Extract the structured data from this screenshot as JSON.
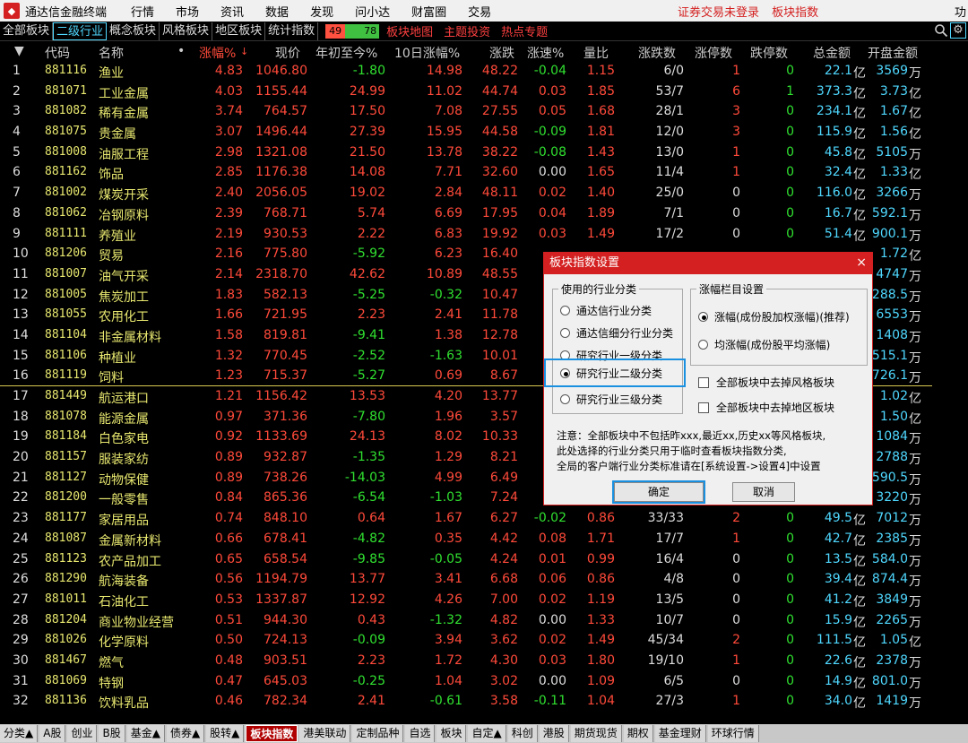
{
  "titlebar": {
    "app_title": "通达信金融终端",
    "menu": [
      "行情",
      "市场",
      "资讯",
      "数据",
      "发现",
      "问小达",
      "财富圈",
      "交易"
    ],
    "notice": [
      "证券交易未登录",
      "板块指数"
    ],
    "func": "功"
  },
  "tabbar": {
    "tabs": [
      "全部板块",
      "二级行业",
      "概念板块",
      "风格板块",
      "地区板块",
      "统计指数"
    ],
    "active_tab": "二级行业",
    "up_count": "49",
    "down_count": "78",
    "links": [
      "板块地图",
      "主题投资",
      "热点专题"
    ]
  },
  "header": {
    "cols": [
      "代码",
      "名称",
      "•",
      "涨幅%",
      "现价",
      "年初至今%",
      "10日涨幅%",
      "涨跌",
      "涨速%",
      "量比",
      "涨跌数",
      "涨停数",
      "跌停数",
      "总金额",
      "开盘金额"
    ]
  },
  "rows": [
    [
      "1",
      "881116",
      "渔业",
      "4.83",
      "1046.80",
      "-1.80",
      "14.98",
      "48.22",
      "-0.04",
      "1.15",
      "6/0",
      "1",
      "0",
      "22.1",
      "亿",
      "3569",
      "万"
    ],
    [
      "2",
      "881071",
      "工业金属",
      "4.03",
      "1155.44",
      "24.99",
      "11.02",
      "44.74",
      "0.03",
      "1.85",
      "53/7",
      "6",
      "1",
      "373.3",
      "亿",
      "3.73",
      "亿"
    ],
    [
      "3",
      "881082",
      "稀有金属",
      "3.74",
      "764.57",
      "17.50",
      "7.08",
      "27.55",
      "0.05",
      "1.68",
      "28/1",
      "3",
      "0",
      "234.1",
      "亿",
      "1.67",
      "亿"
    ],
    [
      "4",
      "881075",
      "贵金属",
      "3.07",
      "1496.44",
      "27.39",
      "15.95",
      "44.58",
      "-0.09",
      "1.81",
      "12/0",
      "3",
      "0",
      "115.9",
      "亿",
      "1.56",
      "亿"
    ],
    [
      "5",
      "881008",
      "油服工程",
      "2.98",
      "1321.08",
      "21.50",
      "13.78",
      "38.22",
      "-0.08",
      "1.43",
      "13/0",
      "1",
      "0",
      "45.8",
      "亿",
      "5105",
      "万"
    ],
    [
      "6",
      "881162",
      "饰品",
      "2.85",
      "1176.38",
      "14.08",
      "7.71",
      "32.60",
      "0.00",
      "1.65",
      "11/4",
      "1",
      "0",
      "32.4",
      "亿",
      "1.33",
      "亿"
    ],
    [
      "7",
      "881002",
      "煤炭开采",
      "2.40",
      "2056.05",
      "19.02",
      "2.84",
      "48.11",
      "0.02",
      "1.40",
      "25/0",
      "0",
      "0",
      "116.0",
      "亿",
      "3266",
      "万"
    ],
    [
      "8",
      "881062",
      "冶钢原料",
      "2.39",
      "768.71",
      "5.74",
      "6.69",
      "17.95",
      "0.04",
      "1.89",
      "7/1",
      "0",
      "0",
      "16.7",
      "亿",
      "592.1",
      "万"
    ],
    [
      "9",
      "881111",
      "养殖业",
      "2.19",
      "930.53",
      "2.22",
      "6.83",
      "19.92",
      "0.03",
      "1.49",
      "17/2",
      "0",
      "0",
      "51.4",
      "亿",
      "900.1",
      "万"
    ],
    [
      "10",
      "881206",
      "贸易",
      "2.16",
      "775.80",
      "-5.92",
      "6.23",
      "16.40",
      "",
      "",
      "",
      "",
      "",
      "",
      "",
      "1.72",
      "亿"
    ],
    [
      "11",
      "881007",
      "油气开采",
      "2.14",
      "2318.70",
      "42.62",
      "10.89",
      "48.55",
      "",
      "",
      "",
      "",
      "",
      "",
      "",
      "4747",
      "万"
    ],
    [
      "12",
      "881005",
      "焦炭加工",
      "1.83",
      "582.13",
      "-5.25",
      "-0.32",
      "10.47",
      "",
      "",
      "",
      "",
      "",
      "",
      "",
      "288.5",
      "万"
    ],
    [
      "13",
      "881055",
      "农用化工",
      "1.66",
      "721.95",
      "2.23",
      "2.41",
      "11.78",
      "",
      "",
      "",
      "",
      "",
      "",
      "",
      "6553",
      "万"
    ],
    [
      "14",
      "881104",
      "非金属材料",
      "1.58",
      "819.81",
      "-9.41",
      "1.38",
      "12.78",
      "",
      "",
      "",
      "",
      "",
      "",
      "",
      "1408",
      "万"
    ],
    [
      "15",
      "881106",
      "种植业",
      "1.32",
      "770.45",
      "-2.52",
      "-1.63",
      "10.01",
      "",
      "",
      "",
      "",
      "",
      "",
      "",
      "515.1",
      "万"
    ],
    [
      "16",
      "881119",
      "饲料",
      "1.23",
      "715.37",
      "-5.27",
      "0.69",
      "8.67",
      "",
      "",
      "",
      "",
      "",
      "",
      "",
      "726.1",
      "万"
    ],
    [
      "17",
      "881449",
      "航运港口",
      "1.21",
      "1156.42",
      "13.53",
      "4.20",
      "13.77",
      "",
      "",
      "",
      "",
      "",
      "",
      "",
      "1.02",
      "亿"
    ],
    [
      "18",
      "881078",
      "能源金属",
      "0.97",
      "371.36",
      "-7.80",
      "1.96",
      "3.57",
      "",
      "",
      "",
      "",
      "",
      "",
      "",
      "1.50",
      "亿"
    ],
    [
      "19",
      "881184",
      "白色家电",
      "0.92",
      "1133.69",
      "24.13",
      "8.02",
      "10.33",
      "",
      "",
      "",
      "",
      "",
      "",
      "",
      "1084",
      "万"
    ],
    [
      "20",
      "881157",
      "服装家纺",
      "0.89",
      "932.87",
      "-1.35",
      "1.29",
      "8.21",
      "",
      "",
      "",
      "",
      "",
      "",
      "",
      "2788",
      "万"
    ],
    [
      "21",
      "881127",
      "动物保健",
      "0.89",
      "738.26",
      "-14.03",
      "4.99",
      "6.49",
      "",
      "",
      "",
      "",
      "",
      "",
      "",
      "590.5",
      "万"
    ],
    [
      "22",
      "881200",
      "一般零售",
      "0.84",
      "865.36",
      "-6.54",
      "-1.03",
      "7.24",
      "",
      "",
      "",
      "",
      "",
      "",
      "",
      "3220",
      "万"
    ],
    [
      "23",
      "881177",
      "家居用品",
      "0.74",
      "848.10",
      "0.64",
      "1.67",
      "6.27",
      "-0.02",
      "0.86",
      "33/33",
      "2",
      "0",
      "49.5",
      "亿",
      "7012",
      "万"
    ],
    [
      "24",
      "881087",
      "金属新材料",
      "0.66",
      "678.41",
      "-4.82",
      "0.35",
      "4.42",
      "0.08",
      "1.71",
      "17/7",
      "1",
      "0",
      "42.7",
      "亿",
      "2385",
      "万"
    ],
    [
      "25",
      "881123",
      "农产品加工",
      "0.65",
      "658.54",
      "-9.85",
      "-0.05",
      "4.24",
      "0.01",
      "0.99",
      "16/4",
      "0",
      "0",
      "13.5",
      "亿",
      "584.0",
      "万"
    ],
    [
      "26",
      "881290",
      "航海装备",
      "0.56",
      "1194.79",
      "13.77",
      "3.41",
      "6.68",
      "0.06",
      "0.86",
      "4/8",
      "0",
      "0",
      "39.4",
      "亿",
      "874.4",
      "万"
    ],
    [
      "27",
      "881011",
      "石油化工",
      "0.53",
      "1337.87",
      "12.92",
      "4.26",
      "7.00",
      "0.02",
      "1.19",
      "13/5",
      "0",
      "0",
      "41.2",
      "亿",
      "3849",
      "万"
    ],
    [
      "28",
      "881204",
      "商业物业经营",
      "0.51",
      "944.30",
      "0.43",
      "-1.32",
      "4.82",
      "0.00",
      "1.33",
      "10/7",
      "0",
      "0",
      "15.9",
      "亿",
      "2265",
      "万"
    ],
    [
      "29",
      "881026",
      "化学原料",
      "0.50",
      "724.13",
      "-0.09",
      "3.94",
      "3.62",
      "0.02",
      "1.49",
      "45/34",
      "2",
      "0",
      "111.5",
      "亿",
      "1.05",
      "亿"
    ],
    [
      "30",
      "881467",
      "燃气",
      "0.48",
      "903.51",
      "2.23",
      "1.72",
      "4.30",
      "0.03",
      "1.80",
      "19/10",
      "1",
      "0",
      "22.6",
      "亿",
      "2378",
      "万"
    ],
    [
      "31",
      "881069",
      "特钢",
      "0.47",
      "645.03",
      "-0.25",
      "1.04",
      "3.02",
      "0.00",
      "1.09",
      "6/5",
      "0",
      "0",
      "14.9",
      "亿",
      "801.0",
      "万"
    ],
    [
      "32",
      "881136",
      "饮料乳品",
      "0.46",
      "782.34",
      "2.41",
      "-0.61",
      "3.58",
      "-0.11",
      "1.04",
      "27/3",
      "1",
      "0",
      "34.0",
      "亿",
      "1419",
      "万"
    ]
  ],
  "bottombar": {
    "tabs": [
      "分类▲",
      "A股",
      "创业",
      "B股",
      "基金▲",
      "债券▲",
      "股转▲",
      "板块指数",
      "港美联动",
      "定制品种",
      "自选",
      "板块",
      "自定▲",
      "科创",
      "港股",
      "期货现货",
      "期权",
      "基金理财",
      "环球行情"
    ],
    "active": "板块指数"
  },
  "dialog": {
    "title": "板块指数设置",
    "close": "×",
    "group1_label": "使用的行业分类",
    "group1_options": [
      "通达信行业分类",
      "通达信细分行业分类",
      "研究行业一级分类",
      "研究行业二级分类",
      "研究行业三级分类"
    ],
    "group1_selected": 3,
    "group2_label": "涨幅栏目设置",
    "group2_options": [
      "涨幅(成份股加权涨幅)(推荐)",
      "均涨幅(成份股平均涨幅)"
    ],
    "group2_selected": 0,
    "checks": [
      "全部板块中去掉风格板块",
      "全部板块中去掉地区板块"
    ],
    "note": [
      "注意：全部板块中不包括昨xxx,最近xx,历史xx等风格板块,",
      "此处选择的行业分类只用于临时查看板块指数分类,",
      "全局的客户端行业分类标准请在[系统设置->设置4]中设置"
    ],
    "ok": "确定",
    "cancel": "取消"
  }
}
